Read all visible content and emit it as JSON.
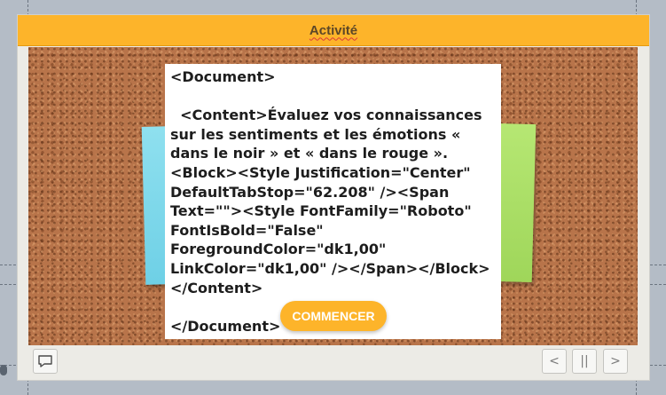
{
  "header": {
    "title": "Activité"
  },
  "card": {
    "text": "<Document>\n\n  <Content>Évaluez vos connaissances sur les sentiments et les émotions « dans le noir » et « dans le rouge ».<Block><Style Justification=\"Center\" DefaultTabStop=\"62.208\" /><Span Text=\"\"><Style FontFamily=\"Roboto\" FontIsBold=\"False\" ForegroundColor=\"dk1,00\" LinkColor=\"dk1,00\" /></Span></Block></Content>\n\n</Document>"
  },
  "actions": {
    "start_label": "COMMENCER"
  },
  "nav": {
    "prev_label": "<",
    "pause_label": "||",
    "next_label": ">"
  },
  "icons": {
    "notes": "speech-bubble-icon",
    "prev": "chevron-left-icon",
    "pause": "pause-icon",
    "next": "chevron-right-icon"
  },
  "colors": {
    "accent": "#fdb42a",
    "title_text": "#5c4727",
    "sticky_blue": "#7fd8ea",
    "sticky_green": "#a8dd64",
    "cork": "#b8744a"
  }
}
